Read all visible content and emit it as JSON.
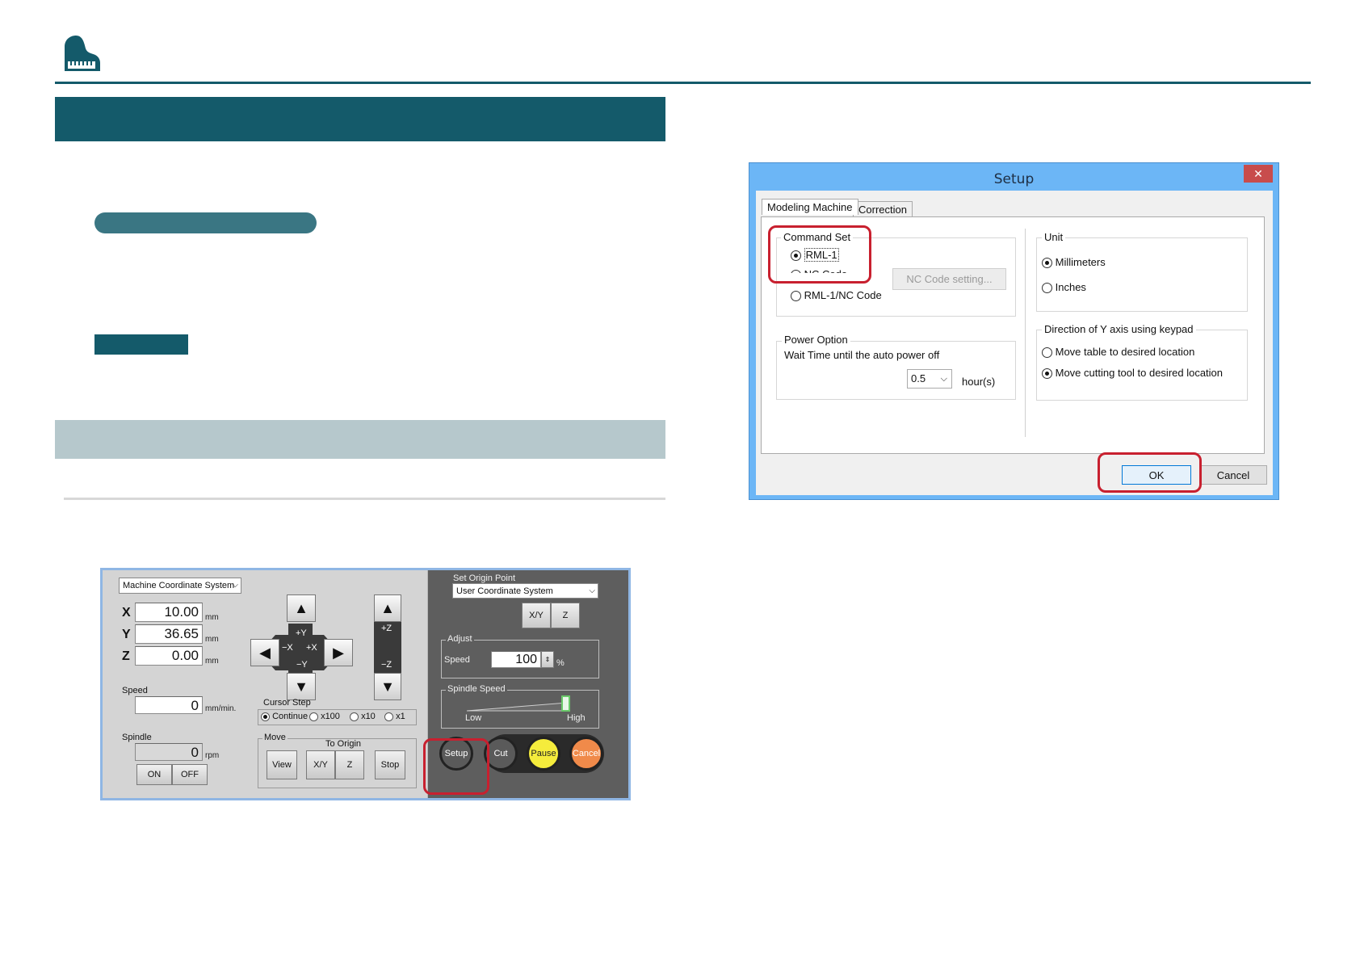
{
  "header": {
    "logo_icon": "grand-piano-logo-icon",
    "accent": "#145a6a"
  },
  "control_panel": {
    "coordinate_system": "Machine Coordinate System",
    "axes": [
      {
        "label": "X",
        "value": "10.00",
        "unit": "mm"
      },
      {
        "label": "Y",
        "value": "36.65",
        "unit": "mm"
      },
      {
        "label": "Z",
        "value": "0.00",
        "unit": "mm"
      }
    ],
    "speed_label": "Speed",
    "speed_value": "0",
    "speed_unit": "mm/min.",
    "spindle_label": "Spindle",
    "spindle_value": "0",
    "spindle_unit": "rpm",
    "on_label": "ON",
    "off_label": "OFF",
    "jog": {
      "up": "▲",
      "down": "▼",
      "left": "◀",
      "right": "▶",
      "plus_y": "+Y",
      "minus_y": "−Y",
      "minus_x": "−X",
      "plus_x": "+X",
      "plus_z": "+Z",
      "minus_z": "−Z"
    },
    "cursor_step_label": "Cursor Step",
    "cursor_steps": [
      "Continue",
      "x100",
      "x10",
      "x1"
    ],
    "move_label": "Move",
    "to_origin_label": "To Origin",
    "move_buttons": [
      "View",
      "X/Y",
      "Z",
      "Stop"
    ],
    "set_origin_label": "Set Origin Point",
    "origin_system": "User Coordinate System",
    "origin_buttons": [
      "X/Y",
      "Z"
    ],
    "adjust_label": "Adjust",
    "adjust_speed_label": "Speed",
    "adjust_speed_value": "100",
    "adjust_speed_unit": "%",
    "spindle_speed_label": "Spindle Speed",
    "low_label": "Low",
    "high_label": "High",
    "setup_label": "Setup",
    "cut_label": "Cut",
    "pause_label": "Pause",
    "cancel_label": "Cancel"
  },
  "setup_dialog": {
    "title": "Setup",
    "close": "✕",
    "tabs": [
      "Modeling Machine",
      "Correction"
    ],
    "command_set_label": "Command Set",
    "command_options": [
      "RML-1",
      "NC Code",
      "RML-1/NC Code"
    ],
    "nc_code_setting": "NC Code setting...",
    "unit_label": "Unit",
    "unit_options": [
      "Millimeters",
      "Inches"
    ],
    "power_option_label": "Power Option",
    "wait_time_label": "Wait Time until the auto power off",
    "wait_time_value": "0.5",
    "wait_time_unit": "hour(s)",
    "direction_label": "Direction of Y axis using keypad",
    "direction_options": [
      "Move table to desired location",
      "Move cutting tool to desired location"
    ],
    "ok_label": "OK",
    "cancel_label": "Cancel"
  }
}
